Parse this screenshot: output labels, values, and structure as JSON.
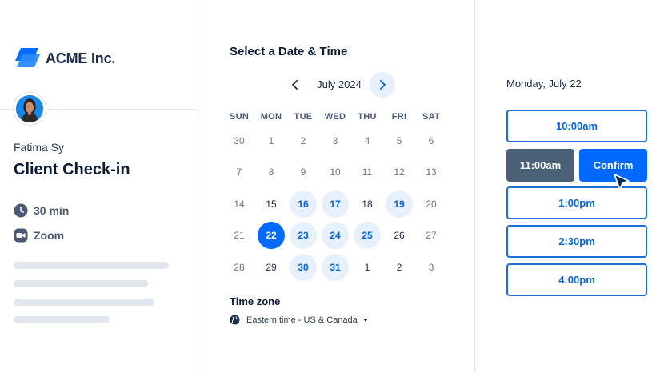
{
  "brand": {
    "name": "ACME Inc.",
    "accent": "#0069ff",
    "logo_icon": "acme-logo-icon"
  },
  "host": {
    "name": "Fatima Sy",
    "avatar_icon": "host-avatar"
  },
  "event": {
    "title": "Client Check-in",
    "duration": "30 min",
    "duration_icon": "clock-icon",
    "location": "Zoom",
    "location_icon": "video-camera-icon"
  },
  "calendar": {
    "heading": "Select a Date & Time",
    "month_label": "July 2024",
    "prev_icon": "chevron-left-icon",
    "next_icon": "chevron-right-icon",
    "weekdays": [
      "SUN",
      "MON",
      "TUE",
      "WED",
      "THU",
      "FRI",
      "SAT"
    ],
    "weeks": [
      [
        {
          "d": "30",
          "s": "muted"
        },
        {
          "d": "1",
          "s": "muted"
        },
        {
          "d": "2",
          "s": "muted"
        },
        {
          "d": "3",
          "s": "muted"
        },
        {
          "d": "4",
          "s": "muted"
        },
        {
          "d": "5",
          "s": "muted"
        },
        {
          "d": "6",
          "s": "muted"
        }
      ],
      [
        {
          "d": "7",
          "s": "muted"
        },
        {
          "d": "8",
          "s": "muted"
        },
        {
          "d": "9",
          "s": "muted"
        },
        {
          "d": "10",
          "s": "muted"
        },
        {
          "d": "11",
          "s": "muted"
        },
        {
          "d": "12",
          "s": "muted"
        },
        {
          "d": "13",
          "s": "muted"
        }
      ],
      [
        {
          "d": "14",
          "s": "muted"
        },
        {
          "d": "15",
          "s": "current"
        },
        {
          "d": "16",
          "s": "avail"
        },
        {
          "d": "17",
          "s": "avail"
        },
        {
          "d": "18",
          "s": "current"
        },
        {
          "d": "19",
          "s": "avail"
        },
        {
          "d": "20",
          "s": "muted"
        }
      ],
      [
        {
          "d": "21",
          "s": "muted"
        },
        {
          "d": "22",
          "s": "selected"
        },
        {
          "d": "23",
          "s": "avail"
        },
        {
          "d": "24",
          "s": "avail"
        },
        {
          "d": "25",
          "s": "avail"
        },
        {
          "d": "26",
          "s": "current"
        },
        {
          "d": "27",
          "s": "muted"
        }
      ],
      [
        {
          "d": "28",
          "s": "muted"
        },
        {
          "d": "29",
          "s": "current"
        },
        {
          "d": "30",
          "s": "avail"
        },
        {
          "d": "31",
          "s": "avail"
        },
        {
          "d": "1",
          "s": "current"
        },
        {
          "d": "2",
          "s": "current"
        },
        {
          "d": "3",
          "s": "muted"
        }
      ]
    ]
  },
  "timezone": {
    "label": "Time zone",
    "value": "Eastern time - US & Canada",
    "globe_icon": "globe-icon",
    "caret_icon": "caret-down-icon"
  },
  "times": {
    "selected_date": "Monday, July 22",
    "slots": [
      "10:00am",
      "1:00pm",
      "2:30pm",
      "4:00pm"
    ],
    "selected_slot": "11:00am",
    "confirm_label": "Confirm",
    "cursor_icon": "pointer-cursor-icon"
  }
}
